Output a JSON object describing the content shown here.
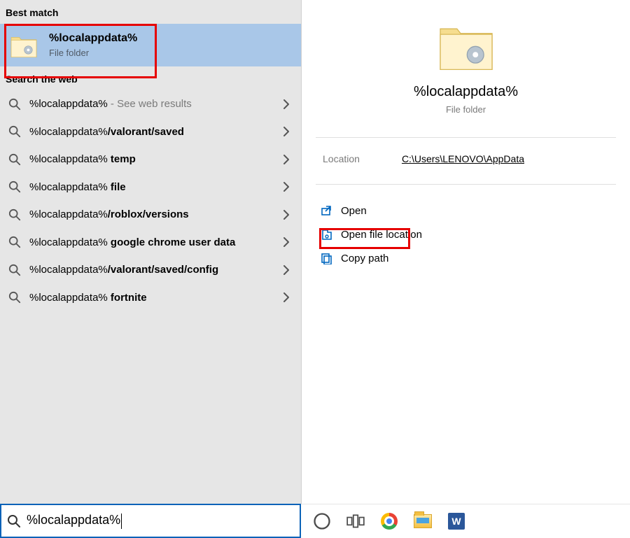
{
  "left": {
    "best_match_header": "Best match",
    "best": {
      "title": "%localappdata%",
      "subtitle": "File folder"
    },
    "web_header": "Search the web",
    "items": [
      {
        "prefix": "%localappdata%",
        "suffix": "",
        "hint": " - See web results"
      },
      {
        "prefix": "%localappdata%",
        "suffix": "/valorant/saved",
        "hint": ""
      },
      {
        "prefix": "%localappdata%",
        "suffix": " temp",
        "hint": ""
      },
      {
        "prefix": "%localappdata%",
        "suffix": " file",
        "hint": ""
      },
      {
        "prefix": "%localappdata%",
        "suffix": "/roblox/versions",
        "hint": ""
      },
      {
        "prefix": "%localappdata%",
        "suffix": " google chrome user data",
        "hint": ""
      },
      {
        "prefix": "%localappdata%",
        "suffix": "/valorant/saved/config",
        "hint": ""
      },
      {
        "prefix": "%localappdata%",
        "suffix": " fortnite",
        "hint": ""
      }
    ]
  },
  "right": {
    "title": "%localappdata%",
    "subtitle": "File folder",
    "location_label": "Location",
    "location_value": "C:\\Users\\LENOVO\\AppData",
    "actions": {
      "open": "Open",
      "open_location": "Open file location",
      "copy_path": "Copy path"
    }
  },
  "taskbar": {
    "search_value": "%localappdata%",
    "word_letter": "W"
  }
}
